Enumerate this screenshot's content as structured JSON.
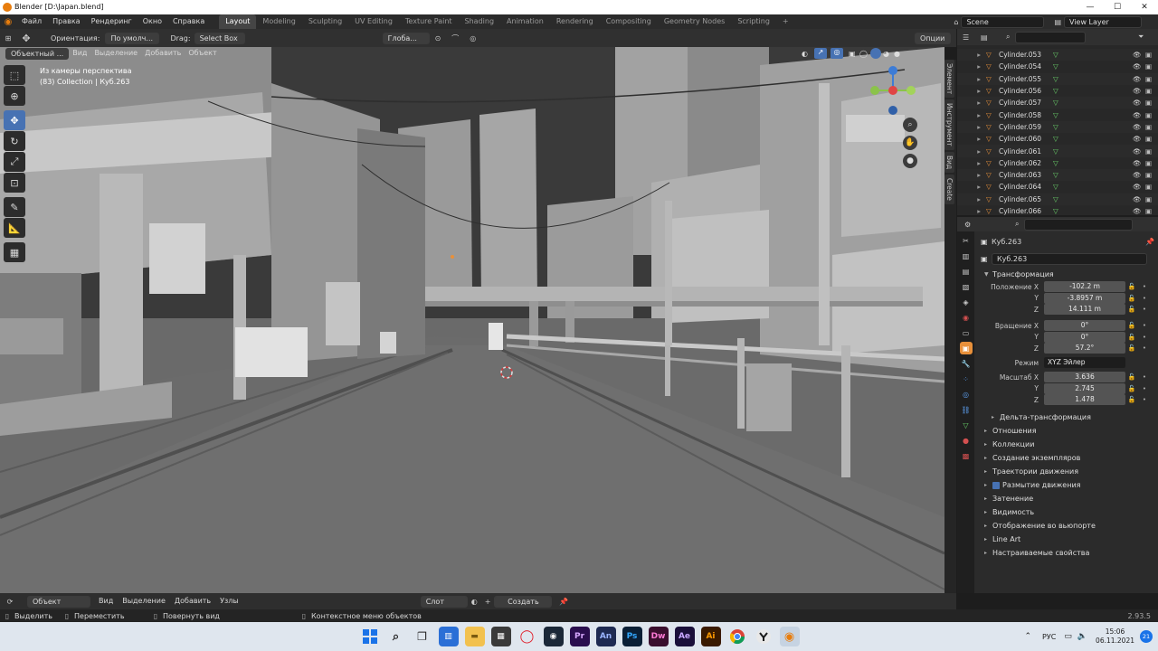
{
  "window": {
    "title": "Blender [D:\\Japan.blend]",
    "minimize": "—",
    "maximize": "☐",
    "close": "✕"
  },
  "menu": {
    "items": [
      "Файл",
      "Правка",
      "Рендеринг",
      "Окно",
      "Справка"
    ],
    "workspaces": [
      "Layout",
      "Modeling",
      "Sculpting",
      "UV Editing",
      "Texture Paint",
      "Shading",
      "Animation",
      "Rendering",
      "Compositing",
      "Geometry Nodes",
      "Scripting"
    ],
    "add_workspace": "+",
    "scene": "Scene",
    "view_layer": "View Layer"
  },
  "viewport_header": {
    "orientation_label": "Ориентация:",
    "orientation_value": "По умолч...",
    "drag_label": "Drag:",
    "drag_value": "Select Box",
    "transform_orientation": "Глоба...",
    "options": "Опции",
    "mode": "Объектный ...",
    "menus": [
      "Вид",
      "Выделение",
      "Добавить",
      "Объект"
    ]
  },
  "viewport": {
    "overlay_line1": "Из камеры перспектива",
    "overlay_line2": "(83) Collection | Куб.263",
    "sidebar_tabs": [
      "Элемент",
      "Инструмент",
      "Вид",
      "Create"
    ]
  },
  "outliner": {
    "search_placeholder": "",
    "rows": [
      "Cylinder.053",
      "Cylinder.054",
      "Cylinder.055",
      "Cylinder.056",
      "Cylinder.057",
      "Cylinder.058",
      "Cylinder.059",
      "Cylinder.060",
      "Cylinder.061",
      "Cylinder.062",
      "Cylinder.063",
      "Cylinder.064",
      "Cylinder.065",
      "Cylinder.066"
    ]
  },
  "properties": {
    "object_name": "Куб.263",
    "object_field": "Куб.263",
    "transform_section": "Трансформация",
    "location_label": "Положение X",
    "rotation_label": "Вращение X",
    "mode_label": "Режим",
    "scale_label": "Масштаб X",
    "axis_y": "Y",
    "axis_z": "Z",
    "location": [
      "-102.2 m",
      "-3.8957 m",
      "14.111 m"
    ],
    "rotation": [
      "0°",
      "0°",
      "57.2°"
    ],
    "rotation_mode": "XYZ Эйлер",
    "scale": [
      "3.636",
      "2.745",
      "1.478"
    ],
    "delta_section": "Дельта-трансформация",
    "sections": [
      "Отношения",
      "Коллекции",
      "Создание экземпляров",
      "Траектории движения",
      "Размытие движения",
      "Затенение",
      "Видимость",
      "Отображение во вьюпорте",
      "Line Art",
      "Настраиваемые свойства"
    ]
  },
  "timeline": {
    "mode": "Объект",
    "menus": [
      "Вид",
      "Выделение",
      "Добавить",
      "Узлы"
    ],
    "slot": "Слот",
    "create": "Создать"
  },
  "status": {
    "select": "Выделить",
    "move": "Переместить",
    "rotate": "Повернуть вид",
    "context": "Контекстное меню объектов",
    "version": "2.93.5"
  },
  "taskbar": {
    "apps": [
      "Pr",
      "An",
      "Ps",
      "Dw",
      "Ae",
      "Ai"
    ],
    "language": "РУС",
    "time": "15:06",
    "date": "06.11.2021",
    "notifications": "21"
  },
  "colors": {
    "accent": "#4772b3",
    "viewport": "#6a6a6a",
    "object_orange": "#e8903a",
    "mesh_green": "#6bd46b"
  }
}
